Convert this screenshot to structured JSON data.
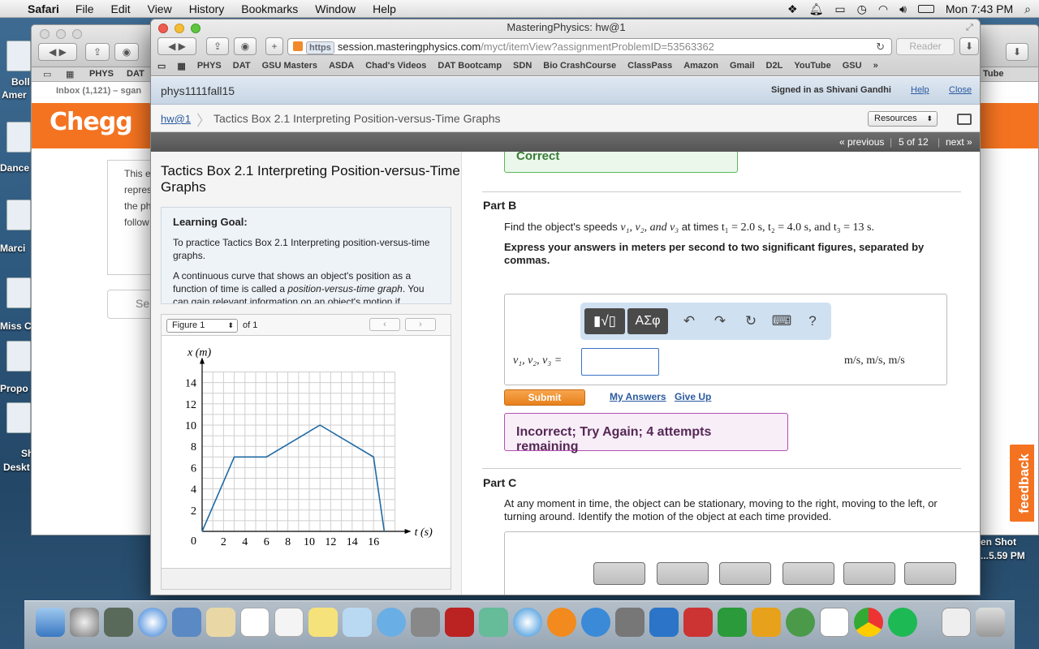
{
  "menubar": {
    "app": "Safari",
    "items": [
      "File",
      "Edit",
      "View",
      "History",
      "Bookmarks",
      "Window",
      "Help"
    ],
    "clock": "Mon 7:43 PM"
  },
  "desktop": {
    "labels": [
      "Boll",
      "Amer",
      "Dance",
      "Marci",
      "Miss C",
      "Propo",
      "Sh",
      "Deskt"
    ],
    "screenshot_label_1": "en Shot",
    "screenshot_label_2": "...5.59 PM"
  },
  "bg_window": {
    "fav_items": [
      "PHYS",
      "DAT"
    ],
    "inbox": "Inbox (1,121) – sgan",
    "chegg_logo": "Chegg",
    "card_lines": [
      "This e",
      "repres",
      "the ph",
      "follow"
    ],
    "select_text": "Sel",
    "right_fav": "Tube"
  },
  "window": {
    "title": "MasteringPhysics: hw@1",
    "url_scheme": "https",
    "url_host": "session.masteringphysics.com",
    "url_path": "/myct/itemView?assignmentProblemID=53563362",
    "reader_label": "Reader",
    "favorites": [
      "PHYS",
      "DAT",
      "GSU Masters",
      "ASDA",
      "Chad's Videos",
      "DAT Bootcamp",
      "SDN",
      "Bio CrashCourse",
      "ClassPass",
      "Amazon",
      "Gmail",
      "D2L",
      "YouTube",
      "GSU"
    ]
  },
  "header": {
    "course": "phys1111fall15",
    "signed_in": "Signed in as Shivani Gandhi",
    "help": "Help",
    "close": "Close"
  },
  "breadcrumb": {
    "home": "hw@1",
    "title": "Tactics Box 2.1 Interpreting Position-versus-Time Graphs",
    "resources": "Resources"
  },
  "pager": {
    "previous": "« previous",
    "position": "5 of 12",
    "next": "next »"
  },
  "problem": {
    "title": "Tactics Box 2.1 Interpreting Position-versus-Time Graphs",
    "goal_heading": "Learning Goal:",
    "goal_text": "To practice Tactics Box 2.1 Interpreting position-versus-time graphs.",
    "intro_text_1": "A continuous curve that shows an object's position as a function of time is called a ",
    "intro_em": "position-versus-time graph",
    "intro_text_2": ".",
    "intro_text_cut": "You can gain relevant information on an object's motion if"
  },
  "figure": {
    "selector": "Figure 1",
    "of": "of 1",
    "prev_icon": "chevron-left-icon",
    "next_icon": "chevron-right-icon"
  },
  "chart_data": {
    "type": "line",
    "xlabel": "t (s)",
    "ylabel": "x (m)",
    "xlim": [
      0,
      18
    ],
    "ylim": [
      0,
      15
    ],
    "xticks": [
      0,
      2,
      4,
      6,
      8,
      10,
      12,
      14,
      16
    ],
    "yticks": [
      2,
      4,
      6,
      8,
      10,
      12,
      14
    ],
    "grid": true,
    "x": [
      0,
      3,
      6,
      11,
      16,
      17
    ],
    "y": [
      0,
      7,
      7,
      10,
      7,
      0
    ],
    "color": "#1f6aa5"
  },
  "partA": {
    "status": "Correct"
  },
  "partB": {
    "heading": "Part B",
    "question_1": "Find the object's speeds ",
    "question_vars": "v₁, v₂, and v₃",
    "question_2": " at times ",
    "question_times": "t₁ = 2.0 s, t₂ = 4.0 s, and t₃ = 13 s.",
    "instruction": "Express your answers in meters per second to two significant figures, separated by commas.",
    "toolbar_template": "▮√▯",
    "toolbar_symbols": "ΑΣφ",
    "undo": "↶",
    "redo": "↷",
    "reset": "↻",
    "keyboard": "⌨",
    "help": "?",
    "var_label": "v₁, v₂, v₃ =",
    "answer_value": "",
    "units": "m/s, m/s, m/s",
    "submit": "Submit",
    "my_answers": "My Answers",
    "give_up": "Give Up",
    "feedback": "Incorrect; Try Again; 4 attempts remaining"
  },
  "partC": {
    "heading": "Part C",
    "question": "At any moment in time, the object can be stationary, moving to the right, moving to the left, or turning around. Identify the motion of the object at each time provided."
  },
  "feedback_tab": "feedback",
  "colors": {
    "chegg_orange": "#f47321",
    "submit_orange": "#e8801b",
    "link_blue": "#2b5aa0",
    "correct_green": "#5cb85c",
    "incorrect_purple": "#b24fb2"
  }
}
